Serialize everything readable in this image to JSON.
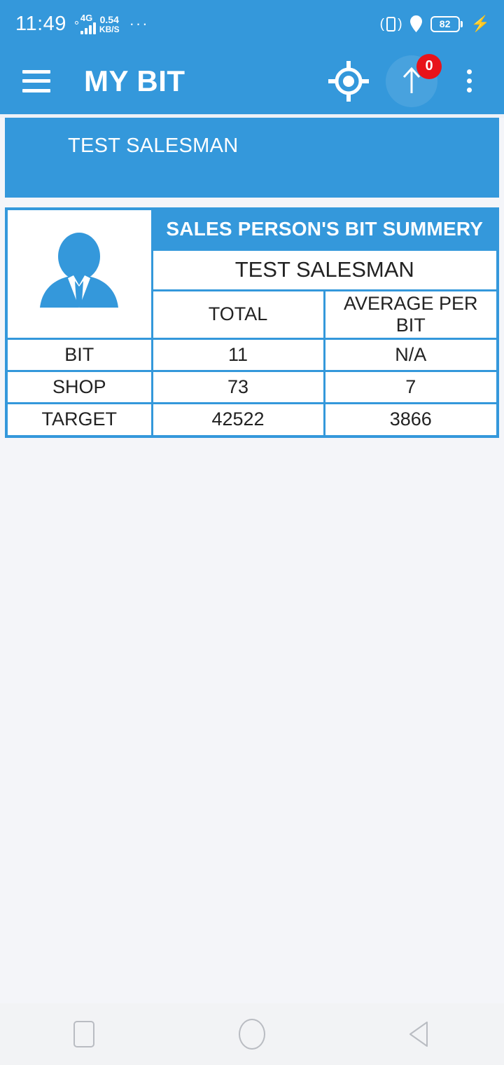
{
  "status_bar": {
    "clock": "11:49",
    "network_generation": "4G",
    "data_speed_value": "0.54",
    "data_speed_unit": "KB/S",
    "overflow": "···",
    "vibrate_icon": "vibrate-icon",
    "location_icon": "location-pin-icon",
    "battery_level": "82",
    "charging_icon": "lightning-bolt-icon"
  },
  "app_bar": {
    "menu_icon": "hamburger-menu-icon",
    "title": "MY BIT",
    "gps_icon": "gps-crosshair-icon",
    "upload_icon": "upload-arrow-icon",
    "upload_badge_count": "0",
    "more_icon": "three-dots-vertical-icon"
  },
  "banner": {
    "salesman_name": "TEST SALESMAN"
  },
  "summary": {
    "avatar_icon": "salesperson-avatar-icon",
    "title": "SALES PERSON'S BIT SUMMERY",
    "person_name": "TEST SALESMAN",
    "column_headers": [
      "TOTAL",
      "AVERAGE PER BIT"
    ],
    "rows": [
      {
        "label": "BIT",
        "total": "11",
        "average": "N/A"
      },
      {
        "label": "SHOP",
        "total": "73",
        "average": "7"
      },
      {
        "label": "TARGET",
        "total": "42522",
        "average": "3866"
      }
    ]
  },
  "nav_bar": {
    "recents_icon": "square-recents-icon",
    "home_icon": "circle-home-icon",
    "back_icon": "triangle-back-icon"
  },
  "colors": {
    "primary_blue": "#3498db",
    "badge_red": "#e8131a",
    "page_background": "#f4f5f9",
    "nav_background": "#f2f3f5"
  }
}
